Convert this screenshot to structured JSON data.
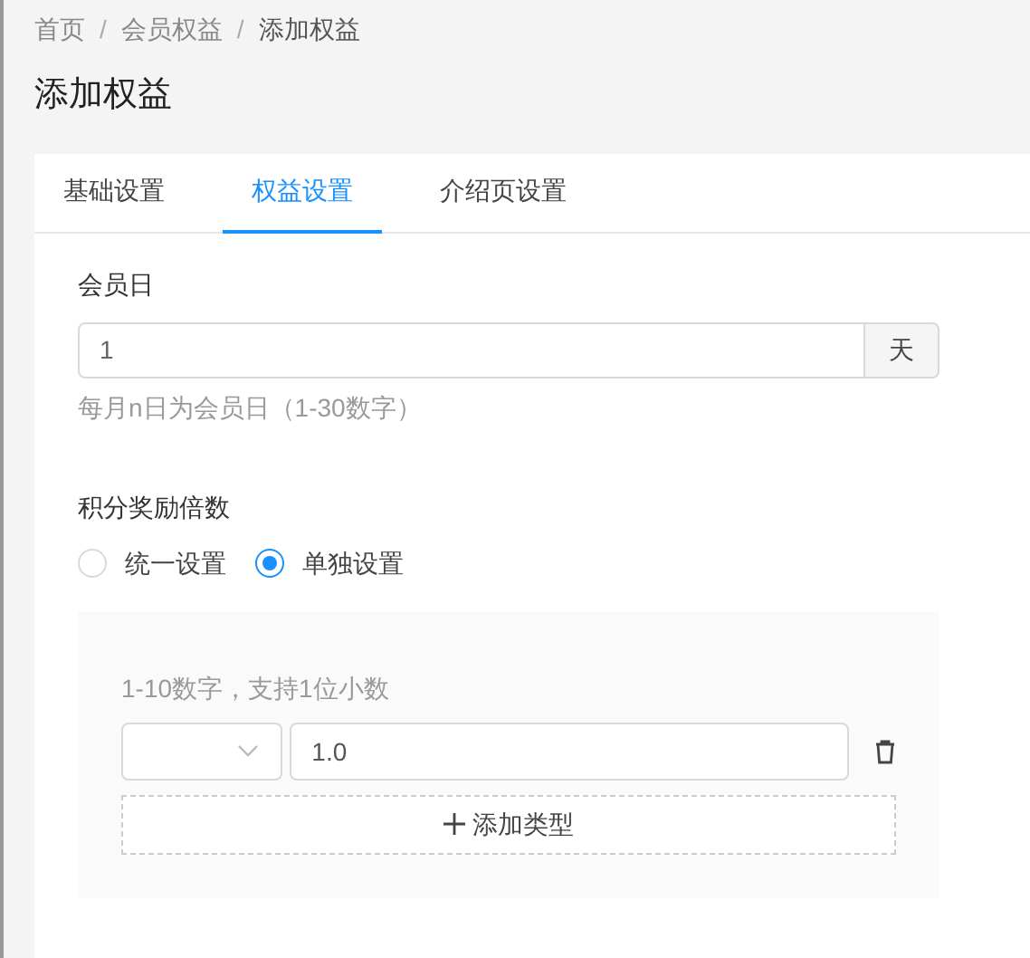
{
  "breadcrumb": [
    {
      "label": "首页"
    },
    {
      "separator": "/",
      "label": "会员权益"
    },
    {
      "separator": "/",
      "label": "添加权益"
    }
  ],
  "title": "添加权益",
  "tabs": [
    {
      "label": "基础设置",
      "selected": false
    },
    {
      "label": "权益设置",
      "selected": true
    },
    {
      "label": "介绍页设置",
      "selected": false
    }
  ],
  "member_day": {
    "label": "会员日",
    "value": "1",
    "suffix": "天",
    "hint": "每月n日为会员日（1-30数字）"
  },
  "points_multiplier": {
    "label": "积分奖励倍数",
    "options": [
      {
        "label": "统一设置",
        "selected": false
      },
      {
        "label": "单独设置",
        "selected": true
      }
    ],
    "hint": "1-10数字，支持1位小数",
    "rows": [
      {
        "value": "1.0"
      }
    ],
    "add_button": "添加类型"
  }
}
